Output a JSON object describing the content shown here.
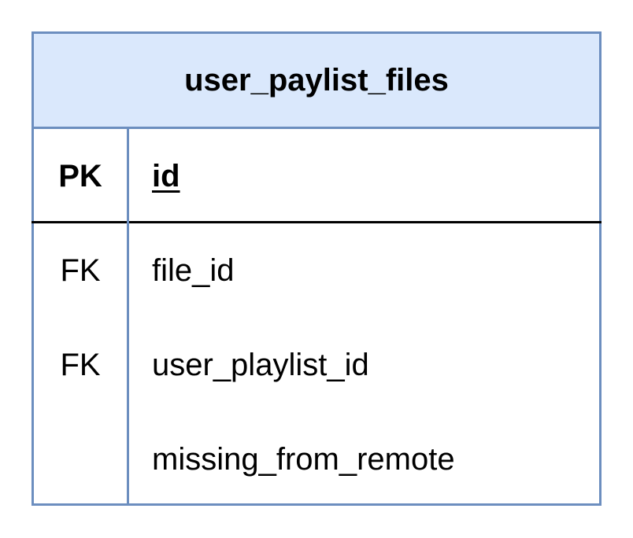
{
  "entity": {
    "title": "user_paylist_files",
    "primary_key": {
      "key": "PK",
      "field": "id"
    },
    "attributes": [
      {
        "key": "FK",
        "field": "file_id"
      },
      {
        "key": "FK",
        "field": "user_playlist_id"
      },
      {
        "key": "",
        "field": "missing_from_remote"
      }
    ]
  },
  "colors": {
    "header_fill": "#dae8fc",
    "border": "#6c8ebf",
    "pk_separator": "#000000"
  }
}
